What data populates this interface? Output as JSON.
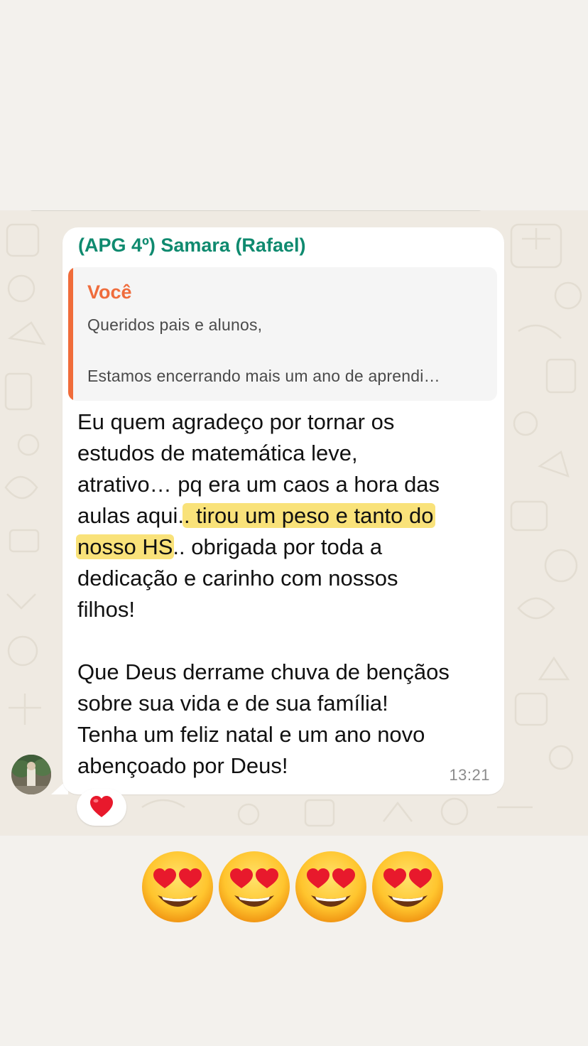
{
  "message": {
    "sender": "(APG 4º) Samara (Rafael)",
    "quoted": {
      "author": "Você",
      "line1": "Queridos pais e alunos,",
      "line2": "Estamos encerrando mais um ano de aprendi…"
    },
    "lines": [
      {
        "text": "Eu quem agradeço por tornar os"
      },
      {
        "text": "estudos de matemática leve,"
      },
      {
        "text": "atrativo… pq era um caos a hora das"
      },
      {
        "pre": "aulas aqui.",
        "hl": ". tirou um peso e tanto do",
        "post": ""
      },
      {
        "pre": "",
        "hl": "nosso HS",
        "post": ".. obrigada por toda a"
      },
      {
        "text": "dedicação e carinho com nossos"
      },
      {
        "text": "filhos!"
      },
      {
        "text": "Que Deus derrame chuva de bençãos"
      },
      {
        "text": "sobre sua vida e de sua família!"
      },
      {
        "text": "Tenha um feliz natal e um ano novo"
      },
      {
        "text": "abençoado por Deus!"
      }
    ],
    "time": "13:21",
    "reaction_icon": "red-heart-icon"
  },
  "emoji_caption": {
    "icon": "smiling-face-with-heart-eyes-icon",
    "count": 4
  },
  "colors": {
    "sender": "#0f8a6f",
    "quote_author": "#ef6c3c",
    "quote_bar": "#f06c3a",
    "highlight": "#f9e27a",
    "bubble": "#ffffff",
    "chat_background": "#efeae2",
    "page_background": "#f3f1ed"
  }
}
